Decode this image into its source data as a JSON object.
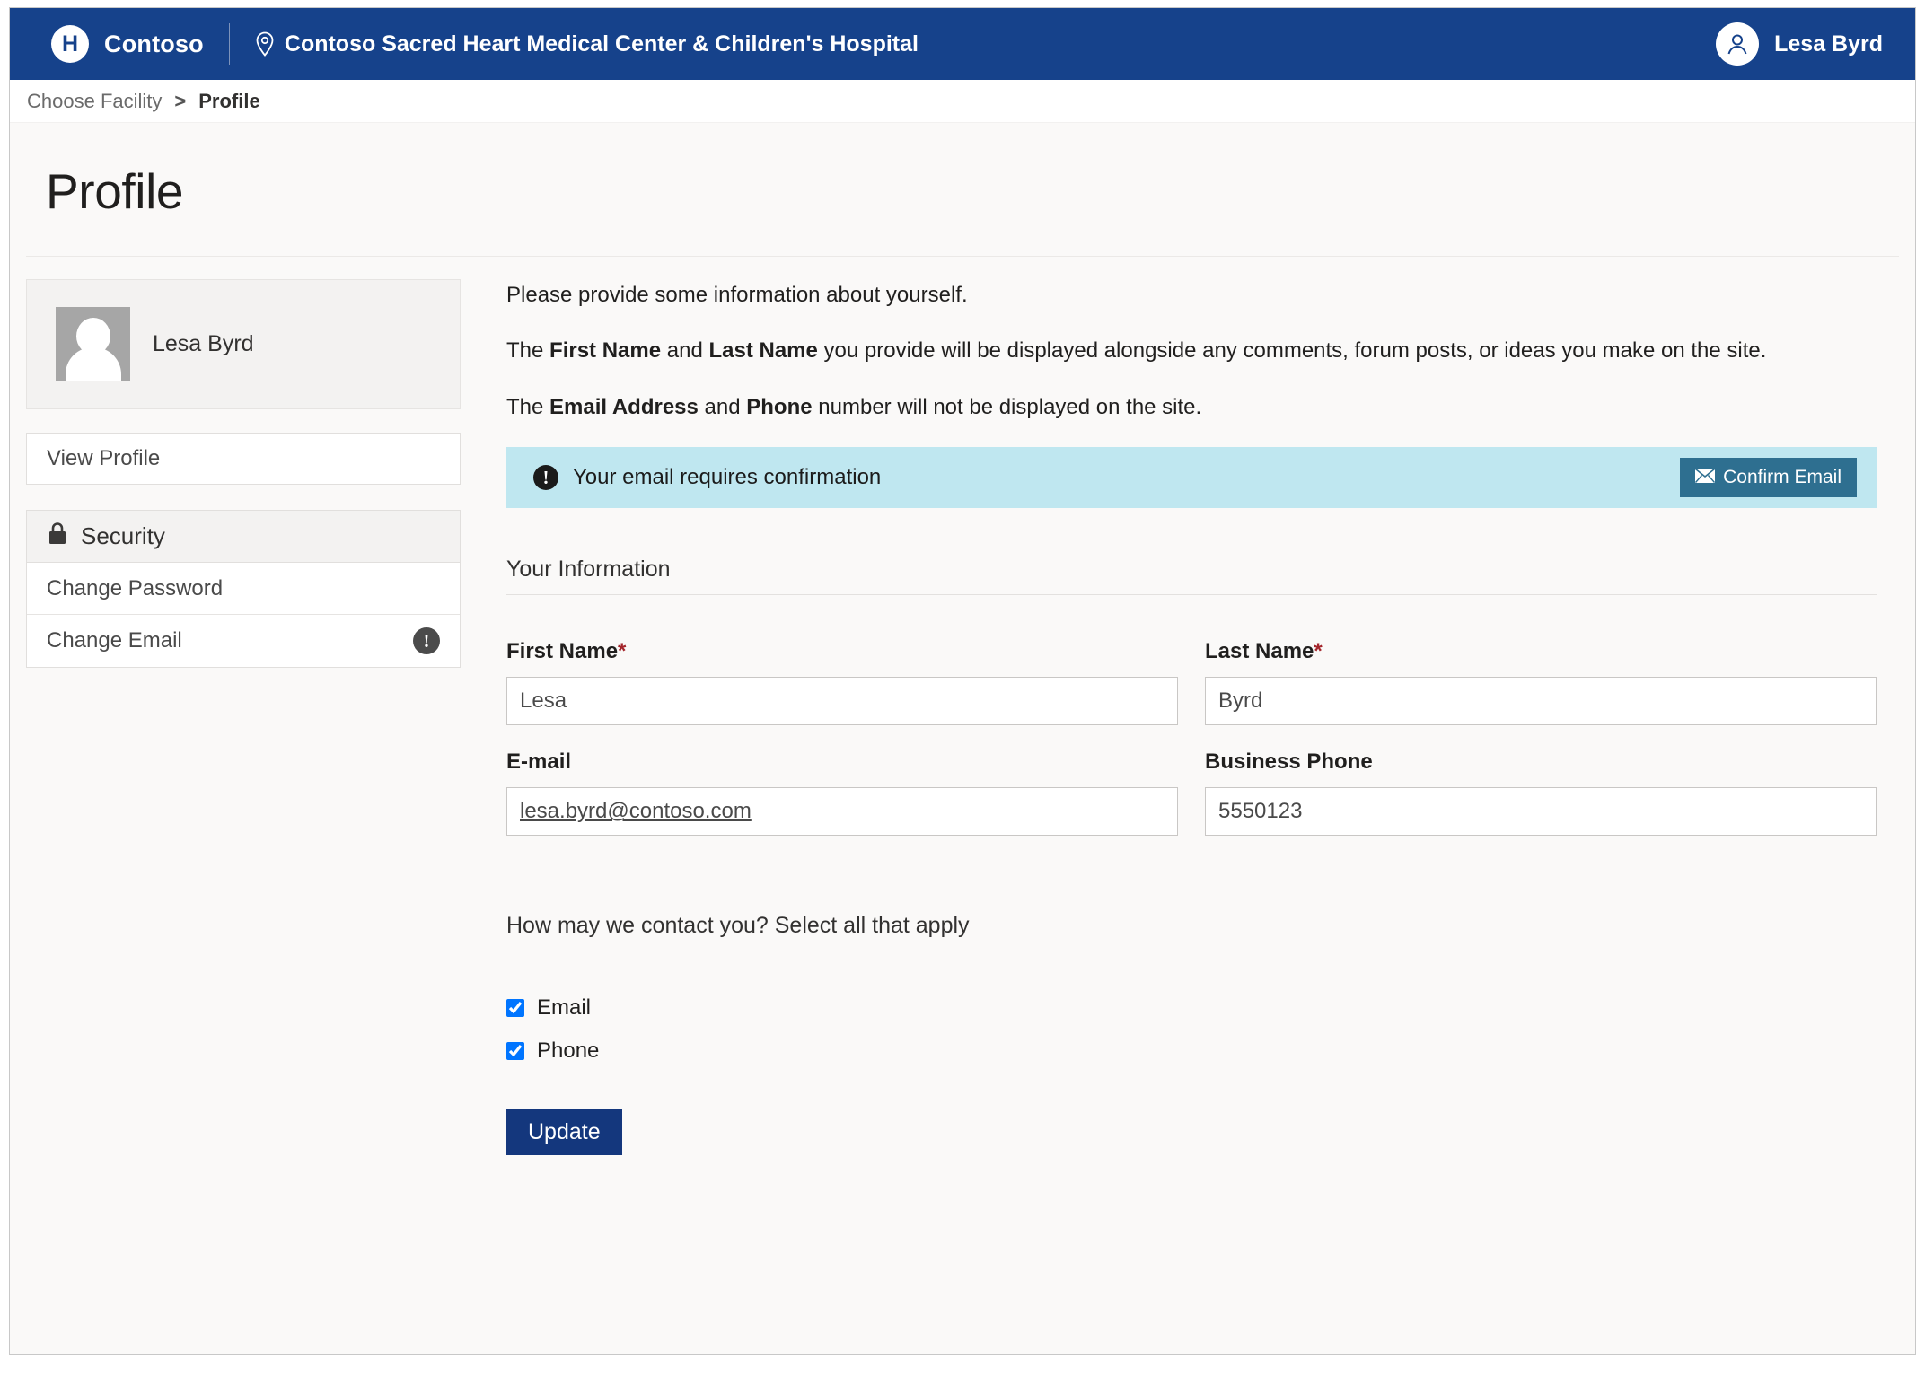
{
  "header": {
    "logo_letter": "H",
    "brand": "Contoso",
    "facility": "Contoso Sacred Heart Medical Center & Children's Hospital",
    "user_name": "Lesa Byrd",
    "brand_color": "#16428b"
  },
  "breadcrumb": {
    "parent": "Choose Facility",
    "separator": ">",
    "current": "Profile"
  },
  "page": {
    "title": "Profile"
  },
  "sidebar": {
    "profile_card": {
      "name": "Lesa Byrd"
    },
    "view_profile": "View Profile",
    "security": {
      "heading": "Security",
      "items": [
        {
          "label": "Change Password",
          "warning": false
        },
        {
          "label": "Change Email",
          "warning": true,
          "warning_glyph": "!"
        }
      ]
    }
  },
  "main": {
    "intro_1": "Please provide some information about yourself.",
    "intro_2": {
      "a": "The ",
      "b1": "First Name",
      "c": " and ",
      "b2": "Last Name",
      "d": " you provide will be displayed alongside any comments, forum posts, or ideas you make on the site."
    },
    "intro_3": {
      "a": "The ",
      "b1": "Email Address",
      "c": " and ",
      "b2": "Phone",
      "d": " number will not be displayed on the site."
    },
    "alert": {
      "icon_glyph": "!",
      "text": "Your email requires confirmation",
      "button_label": "Confirm Email",
      "button_color": "#2e6f90",
      "background": "#bfe7f0"
    },
    "section_info_legend": "Your Information",
    "fields": {
      "first_name": {
        "label": "First Name",
        "required_mark": "*",
        "value": "Lesa"
      },
      "last_name": {
        "label": "Last Name",
        "required_mark": "*",
        "value": "Byrd"
      },
      "email": {
        "label": "E-mail",
        "value": "lesa.byrd@contoso.com"
      },
      "business_phone": {
        "label": "Business Phone",
        "value": "5550123"
      }
    },
    "contact_legend": "How may we contact you? Select all that apply",
    "contact_options": [
      {
        "label": "Email",
        "checked": true
      },
      {
        "label": "Phone",
        "checked": true
      }
    ],
    "update_button": "Update",
    "update_button_color": "#14377d"
  }
}
